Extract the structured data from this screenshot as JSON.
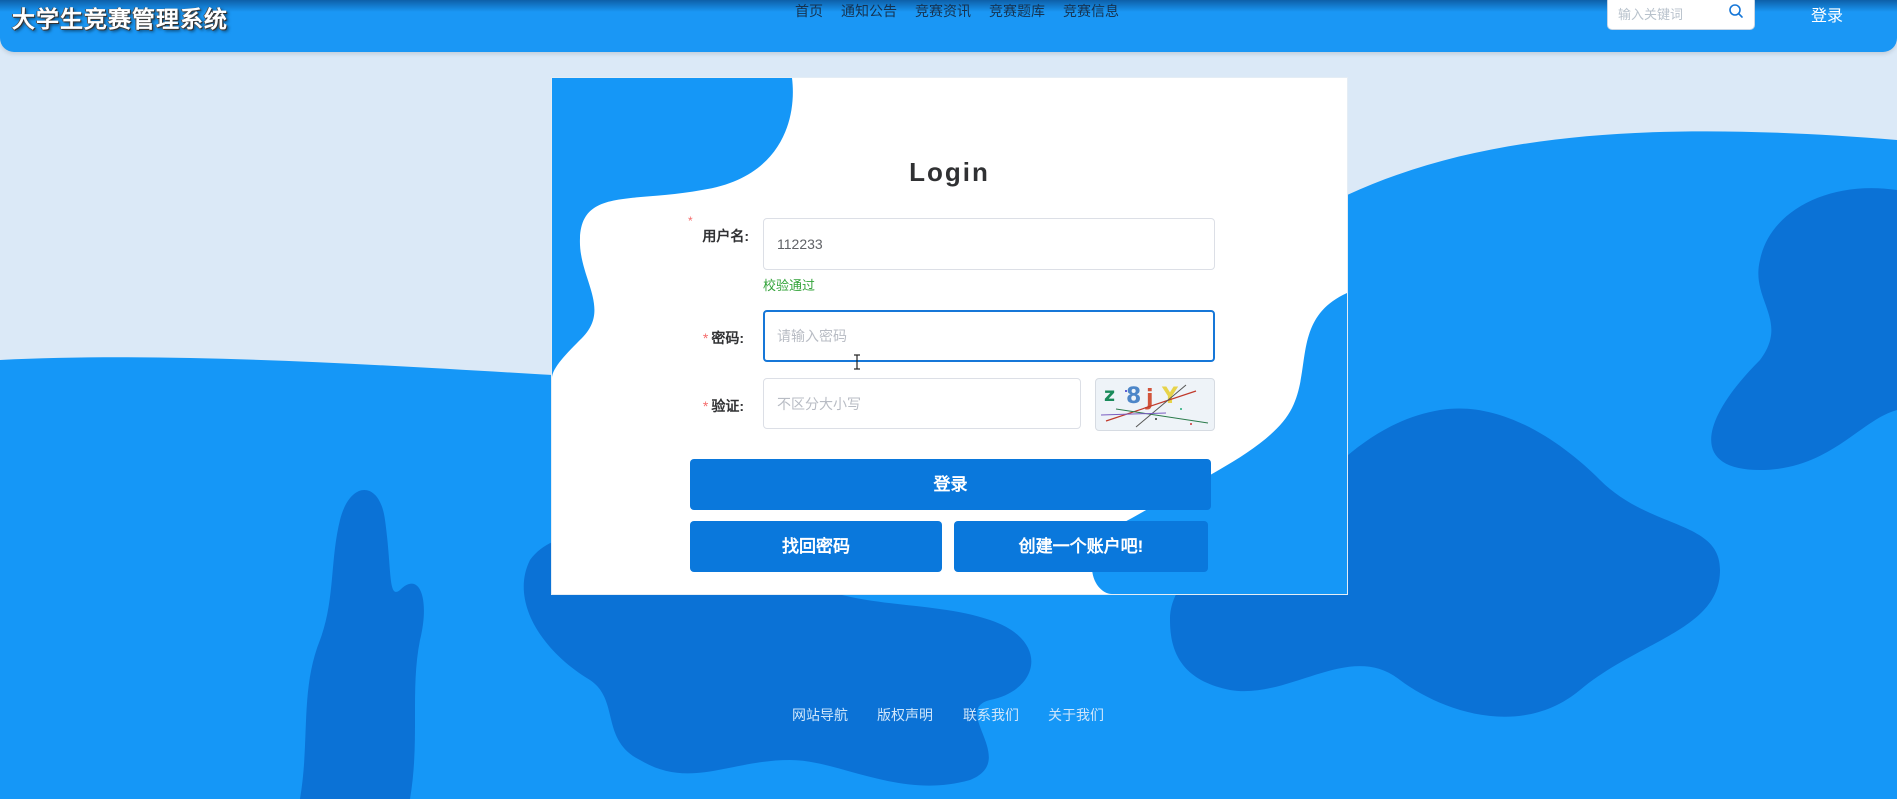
{
  "header": {
    "site_title": "大学生竞赛管理系统",
    "nav": [
      "首页",
      "通知公告",
      "竞赛资讯",
      "竞赛题库",
      "竞赛信息"
    ],
    "search": {
      "placeholder": "输入关键词",
      "icon": "search-icon"
    },
    "login_label": "登录"
  },
  "login_form": {
    "title": "Login",
    "required_mark": "*",
    "username": {
      "label": "用户名:",
      "value": "112233",
      "validation": "校验通过"
    },
    "password": {
      "label": "密码:",
      "placeholder": "请输入密码"
    },
    "captcha": {
      "label": "验证:",
      "placeholder": "不区分大小写",
      "image_text": "z8jY"
    },
    "buttons": {
      "login": "登录",
      "forgot_password": "找回密码",
      "register": "创建一个账户吧!"
    }
  },
  "footer": {
    "links": [
      "网站导航",
      "版权声明",
      "联系我们",
      "关于我们"
    ]
  },
  "colors": {
    "primary": "#1a97f5",
    "button": "#0a78dc",
    "wave_dark": "#0b72d6",
    "background": "#dbe9f7",
    "valid": "#33a33a",
    "required": "#f56c6c"
  }
}
